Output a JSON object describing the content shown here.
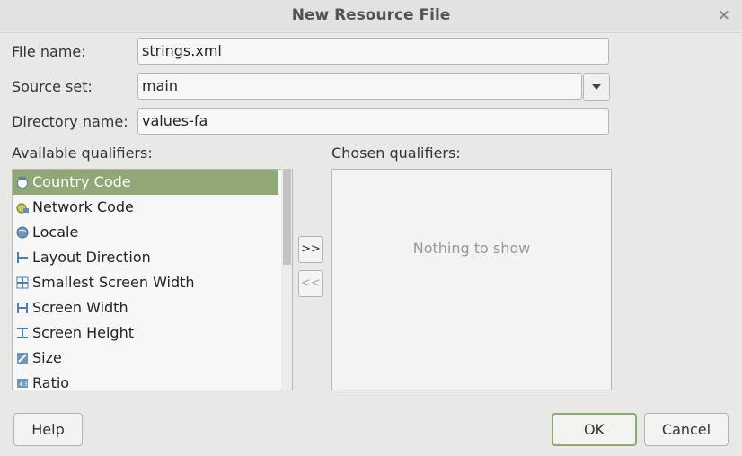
{
  "window": {
    "title": "New Resource File",
    "close_glyph": "×"
  },
  "form": {
    "file_name": {
      "label": "File name:",
      "value": "strings.xml"
    },
    "source_set": {
      "label": "Source set:",
      "value": "main"
    },
    "directory_name": {
      "label": "Directory name:",
      "value": "values-fa"
    }
  },
  "qualifiers": {
    "available_label": "Available qualifiers:",
    "chosen_label": "Chosen qualifiers:",
    "chosen_empty": "Nothing to show",
    "available_items": [
      {
        "label": "Country Code",
        "icon": "country-code-icon",
        "selected": true
      },
      {
        "label": "Network Code",
        "icon": "network-code-icon"
      },
      {
        "label": "Locale",
        "icon": "globe-icon"
      },
      {
        "label": "Layout Direction",
        "icon": "layout-direction-icon"
      },
      {
        "label": "Smallest Screen Width",
        "icon": "smallest-width-icon"
      },
      {
        "label": "Screen Width",
        "icon": "screen-width-icon"
      },
      {
        "label": "Screen Height",
        "icon": "screen-height-icon"
      },
      {
        "label": "Size",
        "icon": "size-icon"
      },
      {
        "label": "Ratio",
        "icon": "ratio-icon"
      }
    ],
    "add_label": ">>",
    "remove_label": "<<"
  },
  "buttons": {
    "help": "Help",
    "ok": "OK",
    "cancel": "Cancel"
  },
  "colors": {
    "accent": "#8fa876",
    "background": "#e8e8e7",
    "field": "#f7f7f7"
  }
}
